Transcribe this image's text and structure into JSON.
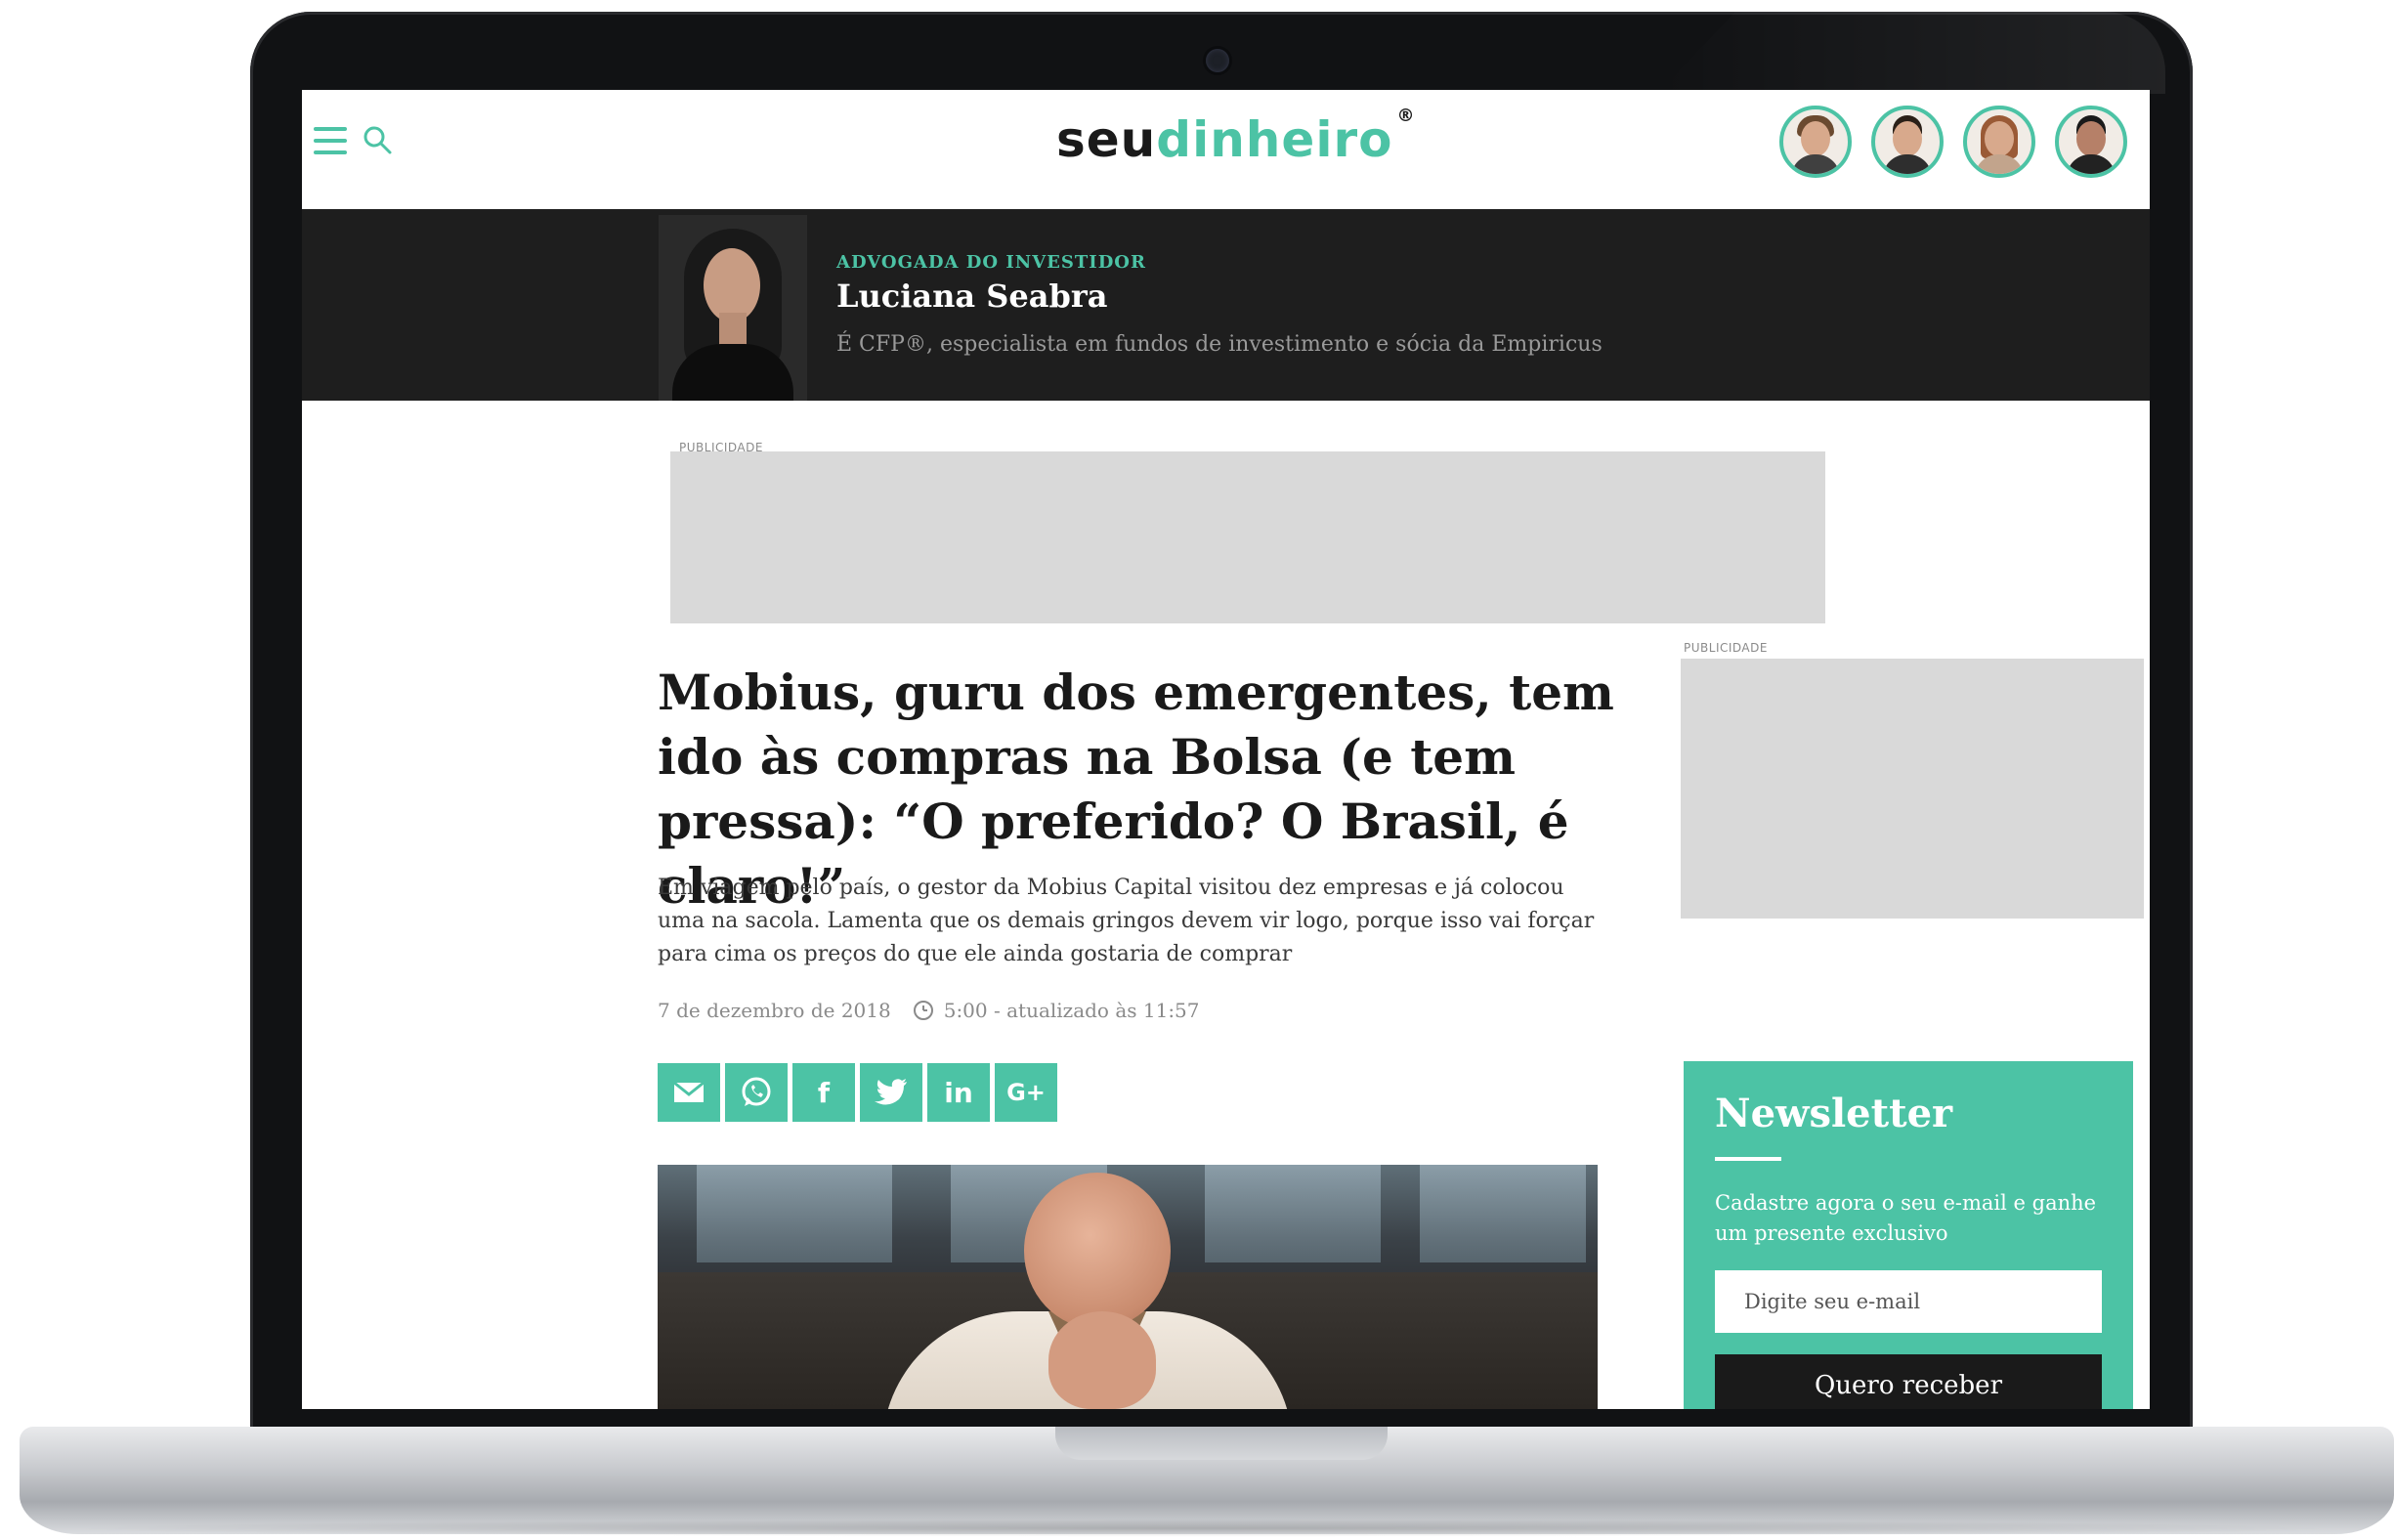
{
  "header": {
    "logo_part1": "seu",
    "logo_part2": "dinheiro",
    "logo_mark": "®",
    "menu_icon": "hamburger-menu-icon",
    "search_icon": "search-icon",
    "avatars": [
      "columnist-avatar-1",
      "columnist-avatar-2",
      "columnist-avatar-3",
      "columnist-avatar-4"
    ]
  },
  "author": {
    "kicker": "ADVOGADA DO INVESTIDOR",
    "name": "Luciana Seabra",
    "bio": "É CFP®, especialista em fundos de investimento e sócia da Empiricus"
  },
  "ads": {
    "top_label": "PUBLICIDADE",
    "side_label": "PUBLICIDADE"
  },
  "article": {
    "headline": "Mobius, guru dos emergentes, tem ido às compras na Bolsa (e tem pressa): “O preferido? O Brasil, é claro!”",
    "lede": "Em viagem pelo país, o gestor da Mobius Capital visitou dez empresas e já colocou uma na sacola. Lamenta que os demais gringos devem vir logo, porque isso vai forçar para cima os preços do que ele ainda gostaria de comprar",
    "date": "7 de dezembro de 2018",
    "time": "5:00 - atualizado às 11:57",
    "share": {
      "email": "email-icon",
      "whatsapp": "whatsapp-icon",
      "facebook": "f",
      "twitter": "twitter-icon",
      "linkedin": "in",
      "googleplus": "G+"
    }
  },
  "newsletter": {
    "title": "Newsletter",
    "text": "Cadastre agora o seu e-mail e ganhe um presente exclusivo",
    "placeholder": "Digite seu e-mail",
    "button": "Quero receber"
  },
  "colors": {
    "accent": "#4cc3a5",
    "dark_band": "#1e1e1e",
    "ad_placeholder": "#d9d9d9"
  }
}
